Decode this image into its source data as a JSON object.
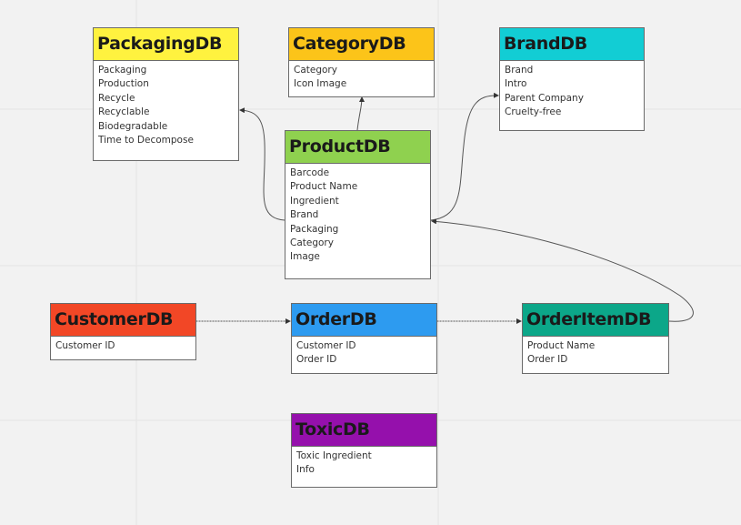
{
  "tables": [
    {
      "id": "packaging",
      "title": "PackagingDB",
      "color": "#fff23f",
      "fields": [
        "Packaging",
        "Production",
        "Recycle",
        "Recyclable",
        "Biodegradable",
        "Time to Decompose"
      ]
    },
    {
      "id": "category",
      "title": "CategoryDB",
      "color": "#fcc419",
      "fields": [
        "Category",
        "Icon Image"
      ]
    },
    {
      "id": "brand",
      "title": "BrandDB",
      "color": "#12cdd4",
      "fields": [
        "Brand",
        "Intro",
        "Parent Company",
        "Cruelty-free"
      ]
    },
    {
      "id": "product",
      "title": "ProductDB",
      "color": "#8fd14f",
      "fields": [
        "Barcode",
        "Product Name",
        "Ingredient",
        "Brand",
        "Packaging",
        "Category",
        "Image"
      ]
    },
    {
      "id": "customer",
      "title": "CustomerDB",
      "color": "#f24726",
      "fields": [
        "Customer ID"
      ]
    },
    {
      "id": "order",
      "title": "OrderDB",
      "color": "#2d9bf0",
      "fields": [
        "Customer ID",
        "Order ID"
      ]
    },
    {
      "id": "orderitem",
      "title": "OrderItemDB",
      "color": "#0ca789",
      "fields": [
        "Product Name",
        "Order ID"
      ]
    },
    {
      "id": "toxic",
      "title": "ToxicDB",
      "color": "#9510ac",
      "fields": [
        "Toxic Ingredient",
        "Info"
      ]
    }
  ],
  "connections": [
    {
      "from": "ProductDB",
      "to": "PackagingDB"
    },
    {
      "from": "ProductDB",
      "to": "CategoryDB"
    },
    {
      "from": "ProductDB",
      "to": "BrandDB"
    },
    {
      "from": "OrderItemDB",
      "to": "ProductDB"
    },
    {
      "from": "CustomerDB",
      "to": "OrderDB"
    },
    {
      "from": "OrderDB",
      "to": "OrderItemDB"
    }
  ]
}
